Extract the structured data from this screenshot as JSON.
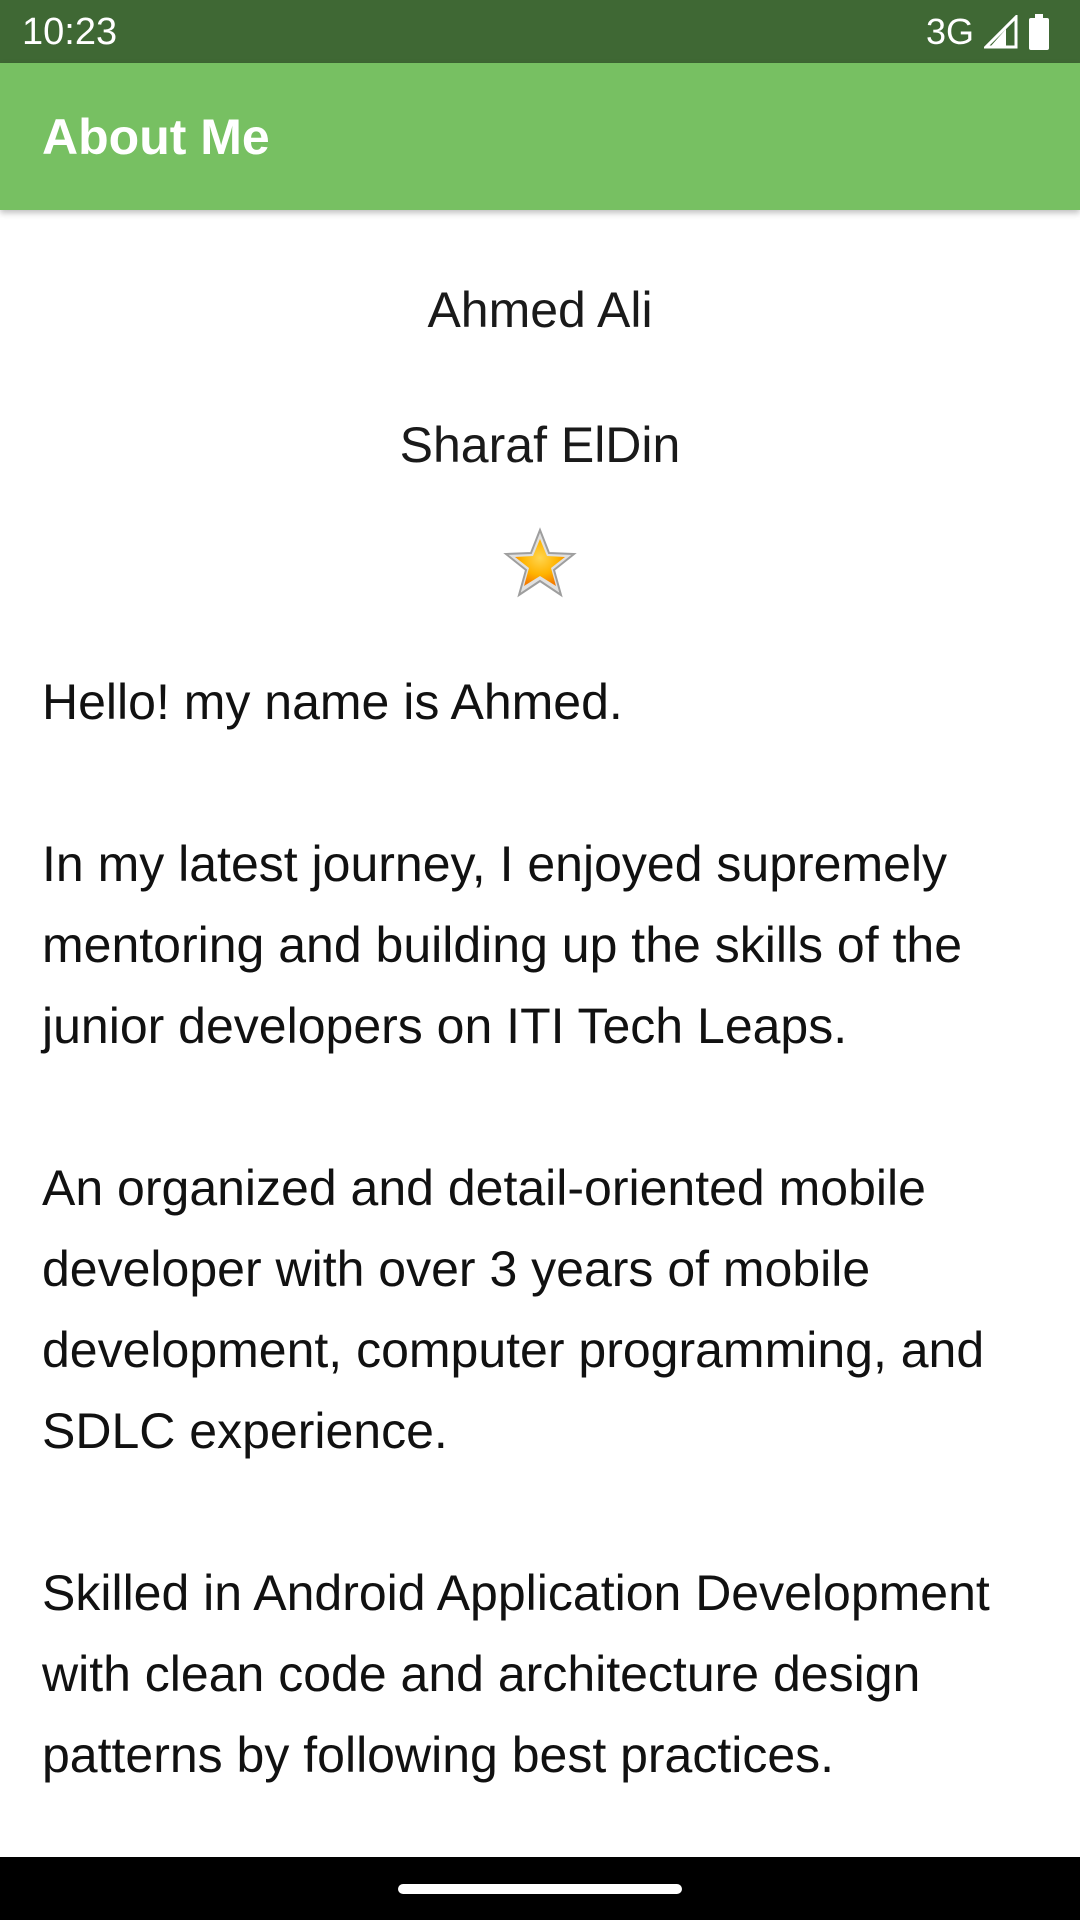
{
  "status_bar": {
    "time": "10:23",
    "network": "3G",
    "signal_icon": "signal-icon",
    "battery_icon": "battery-icon"
  },
  "app_bar": {
    "title": "About Me",
    "color": "#77C062"
  },
  "profile": {
    "first_name": "Ahmed Ali",
    "last_name": "Sharaf ElDin",
    "star_icon": "star-icon"
  },
  "bio": {
    "text": "Hello! my name is Ahmed.\n\nIn my latest journey, I enjoyed supremely mentoring and building up the skills of the junior developers on ITI Tech Leaps.\n\nAn organized and detail-oriented mobile developer with over 3 years of mobile development, computer programming, and SDLC experience.\n\nSkilled in Android Application Development with clean code and architecture design patterns by following best practices."
  },
  "colors": {
    "status_bar": "#3F6834",
    "app_bar": "#77C062",
    "background": "#FFFFFF"
  }
}
